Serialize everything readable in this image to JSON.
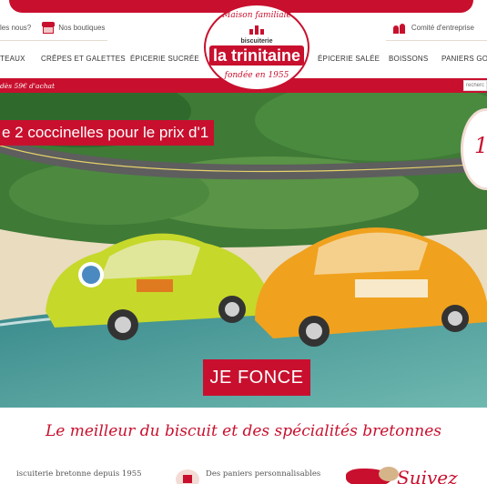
{
  "header": {
    "utility_left": [
      {
        "label": "les nous?"
      },
      {
        "label": "Nos boutiques"
      }
    ],
    "utility_right": [
      {
        "label": "Comité d'entreprise"
      }
    ],
    "logo": {
      "tagline_top": "Maison familiale",
      "biscuiterie": "biscuiterie",
      "brand": "la trinitaine",
      "tagline_bottom": "fondée en 1955"
    },
    "nav": [
      "TEAUX",
      "CRÊPES ET GALETTES",
      "ÉPICERIE SUCRÉE",
      "ÉPICERIE SALÉE",
      "BOISSONS",
      "PANIERS GOU"
    ]
  },
  "promo_bar": {
    "text": "dès 59€ d'achat",
    "search_placeholder": "recherc"
  },
  "hero": {
    "title": "e 2 coccinelles pour le prix d'1",
    "badge": "1",
    "cta": "JE FONCE"
  },
  "tagline": "Le meilleur du biscuit et des spécialités bretonnes",
  "features": [
    {
      "label": "iscuiterie bretonne depuis 1955"
    },
    {
      "label": "Des paniers personnalisables"
    }
  ],
  "follow": {
    "label": "Suivez"
  },
  "colors": {
    "brand_red": "#c8102e"
  }
}
